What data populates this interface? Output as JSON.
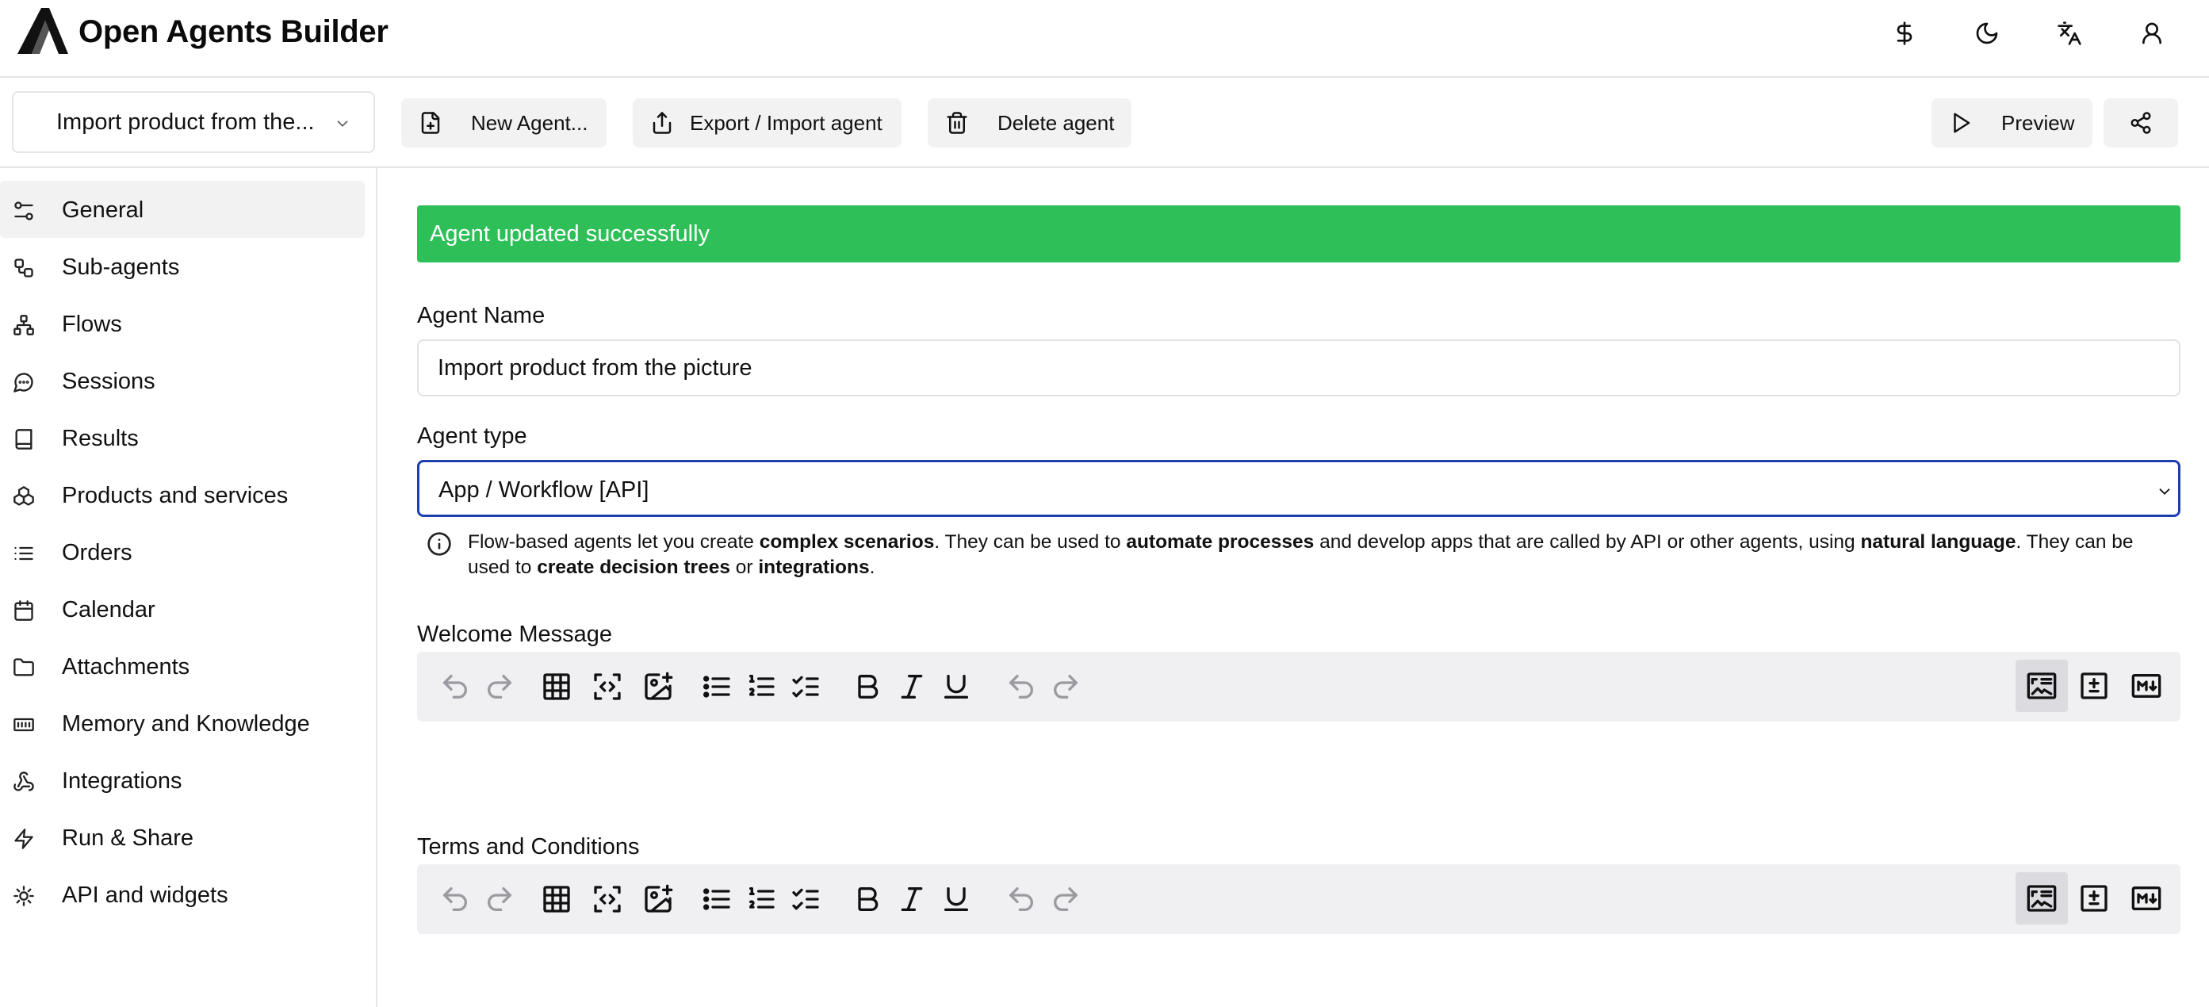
{
  "header": {
    "app_title": "Open Agents Builder",
    "icons": [
      "logo-icon",
      "dollar-icon",
      "moon-icon",
      "translate-icon",
      "user-icon"
    ]
  },
  "toolbar": {
    "agent_select_value": "Import product from the...",
    "new_agent_label": "New Agent...",
    "export_import_label": "Export / Import agent",
    "delete_label": "Delete agent",
    "preview_label": "Preview"
  },
  "sidebar": {
    "items": [
      {
        "label": "General",
        "icon": "sliders-icon",
        "active": true
      },
      {
        "label": "Sub-agents",
        "icon": "workflow-icon",
        "active": false
      },
      {
        "label": "Flows",
        "icon": "network-icon",
        "active": false
      },
      {
        "label": "Sessions",
        "icon": "message-icon",
        "active": false
      },
      {
        "label": "Results",
        "icon": "book-icon",
        "active": false
      },
      {
        "label": "Products and services",
        "icon": "boxes-icon",
        "active": false
      },
      {
        "label": "Orders",
        "icon": "list-icon",
        "active": false
      },
      {
        "label": "Calendar",
        "icon": "calendar-icon",
        "active": false
      },
      {
        "label": "Attachments",
        "icon": "folder-icon",
        "active": false
      },
      {
        "label": "Memory and Knowledge",
        "icon": "memory-icon",
        "active": false
      },
      {
        "label": "Integrations",
        "icon": "webhook-icon",
        "active": false
      },
      {
        "label": "Run & Share",
        "icon": "zap-icon",
        "active": false
      },
      {
        "label": "API and widgets",
        "icon": "cog-icon",
        "active": false
      }
    ]
  },
  "main": {
    "alert": "Agent updated successfully",
    "agent_name_label": "Agent Name",
    "agent_name_value": "Import product from the picture",
    "agent_type_label": "Agent type",
    "agent_type_value": "App / Workflow [API]",
    "help": {
      "t1": "Flow-based agents let you create ",
      "b1": "complex scenarios",
      "t2": ". They can be used to ",
      "b2": "automate processes",
      "t3": " and develop apps that are called by API or other agents, using ",
      "b3": "natural language",
      "t4": ". They can be used to ",
      "b4": "create decision trees",
      "t5": " or ",
      "b5": "integrations",
      "t6": "."
    },
    "welcome_label": "Welcome Message",
    "terms_label": "Terms and Conditions"
  },
  "colors": {
    "success": "#2ebf58",
    "focus_border": "#1e40af",
    "active_bg": "#f2f2f2"
  }
}
